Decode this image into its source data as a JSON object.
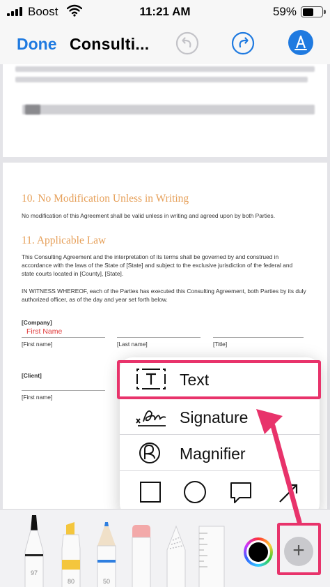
{
  "status": {
    "carrier": "Boost",
    "time": "11:21 AM",
    "battery": "59%",
    "battery_level": 0.59
  },
  "nav": {
    "done_label": "Done",
    "title": "Consulti...",
    "icons": [
      "undo-icon",
      "redo-icon",
      "markup-pen-icon"
    ]
  },
  "document": {
    "section10": {
      "heading": "10. No Modification Unless in Writing",
      "body": "No modification of this Agreement shall be valid unless in writing and agreed upon by both Parties."
    },
    "section11": {
      "heading": "11. Applicable Law",
      "body": [
        "This Consulting Agreement and the interpretation of its terms shall be governed by and construed in",
        "accordance with the laws of the State of [State] and subject to the exclusive jurisdiction of the federal and",
        "state courts located in [County], [State]."
      ]
    },
    "witness": [
      "IN WITNESS WHEREOF, each of the Parties has executed this Consulting Agreement, both Parties by its duly",
      "authorized officer, as of the day and year set forth below."
    ],
    "company_label": "[Company]",
    "first_name_field": "First Name",
    "sig_fields": [
      "[First name]",
      "[Last name]",
      "[Title]"
    ],
    "client_label": "[Client]",
    "client_field": "[First name]"
  },
  "menu": {
    "items": [
      {
        "label": "Text",
        "icon": "text-box-icon"
      },
      {
        "label": "Signature",
        "icon": "signature-icon"
      },
      {
        "label": "Magnifier",
        "icon": "magnifier-icon"
      }
    ],
    "shapes": [
      "square-shape-icon",
      "circle-shape-icon",
      "speech-bubble-shape-icon",
      "arrow-shape-icon"
    ]
  },
  "tools": [
    {
      "name": "pen",
      "value": "97"
    },
    {
      "name": "highlighter",
      "value": "80"
    },
    {
      "name": "pencil",
      "value": "50"
    },
    {
      "name": "eraser"
    },
    {
      "name": "lasso"
    },
    {
      "name": "ruler"
    }
  ],
  "colors": {
    "accent": "#1f7ae0",
    "highlight": "#e8336b",
    "heading": "#e6a05a",
    "field_red": "#e03a3a",
    "selected_color": "#000000"
  }
}
